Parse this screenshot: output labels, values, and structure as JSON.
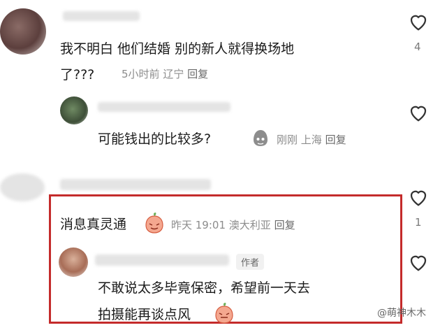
{
  "comments": [
    {
      "text_line1": "我不明白 他们结婚 别的新人就得换场地",
      "text_line2": "了???",
      "time": "5小时前",
      "location": "辽宁",
      "reply": "回复",
      "likes": "4"
    },
    {
      "text": "可能钱出的比较多?",
      "time": "刚刚",
      "location": "上海",
      "reply": "回复"
    },
    {
      "text": "消息真灵通",
      "time": "昨天 19:01",
      "location": "澳大利亚",
      "reply": "回复",
      "likes": "1"
    },
    {
      "author_tag": "作者",
      "text_line1": "不敢说太多毕竟保密，希望前一天去",
      "text_line2": "拍摄能再谈点风"
    }
  ],
  "watermark": "@萌神木木",
  "accent_color": "#c42b2b",
  "icons": [
    "heart-outline-icon",
    "emoji-icon"
  ]
}
